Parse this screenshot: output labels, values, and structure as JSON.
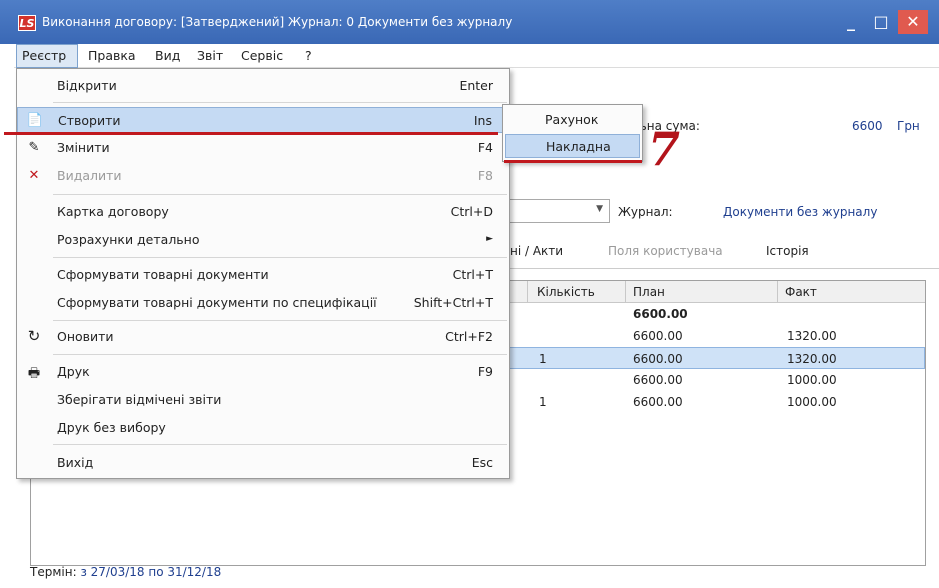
{
  "window": {
    "title": "Виконання договору: [Затверджений] Журнал: 0 Документи без журналу",
    "app_icon": "LS",
    "minimize": "_",
    "maximize": "□",
    "close": "✕"
  },
  "menubar": {
    "items": [
      "Реєстр",
      "Правка",
      "Вид",
      "Звіт",
      "Сервіс",
      "?"
    ]
  },
  "background": {
    "total_label": "льна сума:",
    "total_value": "6600",
    "currency": "Грн",
    "journal_label": "Журнал:",
    "journal_value": "Документи без журналу",
    "tabs": [
      "ні / Акти",
      "Поля користувача",
      "Історія"
    ],
    "grid": {
      "columns": [
        "Кількість",
        "План",
        "Факт"
      ],
      "rows": [
        {
          "qty": "",
          "plan": "6600.00",
          "fact": "",
          "bold": true
        },
        {
          "qty": "",
          "plan": "6600.00",
          "fact": "1320.00"
        },
        {
          "qty": "1",
          "plan": "6600.00",
          "fact": "1320.00",
          "selected": true
        },
        {
          "qty": "",
          "plan": "6600.00",
          "fact": "1000.00"
        },
        {
          "qty": "1",
          "plan": "6600.00",
          "fact": "1000.00"
        }
      ]
    },
    "status_label": "Термін:",
    "status_value": "з 27/03/18 по 31/12/18"
  },
  "dropdown": {
    "items": [
      {
        "label": "Відкрити",
        "shortcut": "Enter"
      },
      {
        "label": "Створити",
        "shortcut": "Ins",
        "icon": "new-doc-icon"
      },
      {
        "label": "Змінити",
        "shortcut": "F4",
        "icon": "edit-doc-icon"
      },
      {
        "label": "Видалити",
        "shortcut": "F8",
        "icon": "delete-doc-icon"
      },
      {
        "label": "Картка договору",
        "shortcut": "Ctrl+D"
      },
      {
        "label": "Розрахунки детально",
        "shortcut": "►"
      },
      {
        "label": "Сформувати товарні документи",
        "shortcut": "Ctrl+T"
      },
      {
        "label": "Сформувати товарні документи по специфікації",
        "shortcut": "Shift+Ctrl+T"
      },
      {
        "label": "Оновити",
        "shortcut": "Ctrl+F2",
        "icon": "refresh-icon"
      },
      {
        "label": "Друк",
        "shortcut": "F9",
        "icon": "printer-icon"
      },
      {
        "label": "Зберігати відмічені звіти",
        "shortcut": ""
      },
      {
        "label": "Друк без вибору",
        "shortcut": ""
      },
      {
        "label": "Вихід",
        "shortcut": "Esc"
      }
    ]
  },
  "submenu": {
    "items": [
      "Рахунок",
      "Накладна"
    ]
  },
  "annotation": "7"
}
